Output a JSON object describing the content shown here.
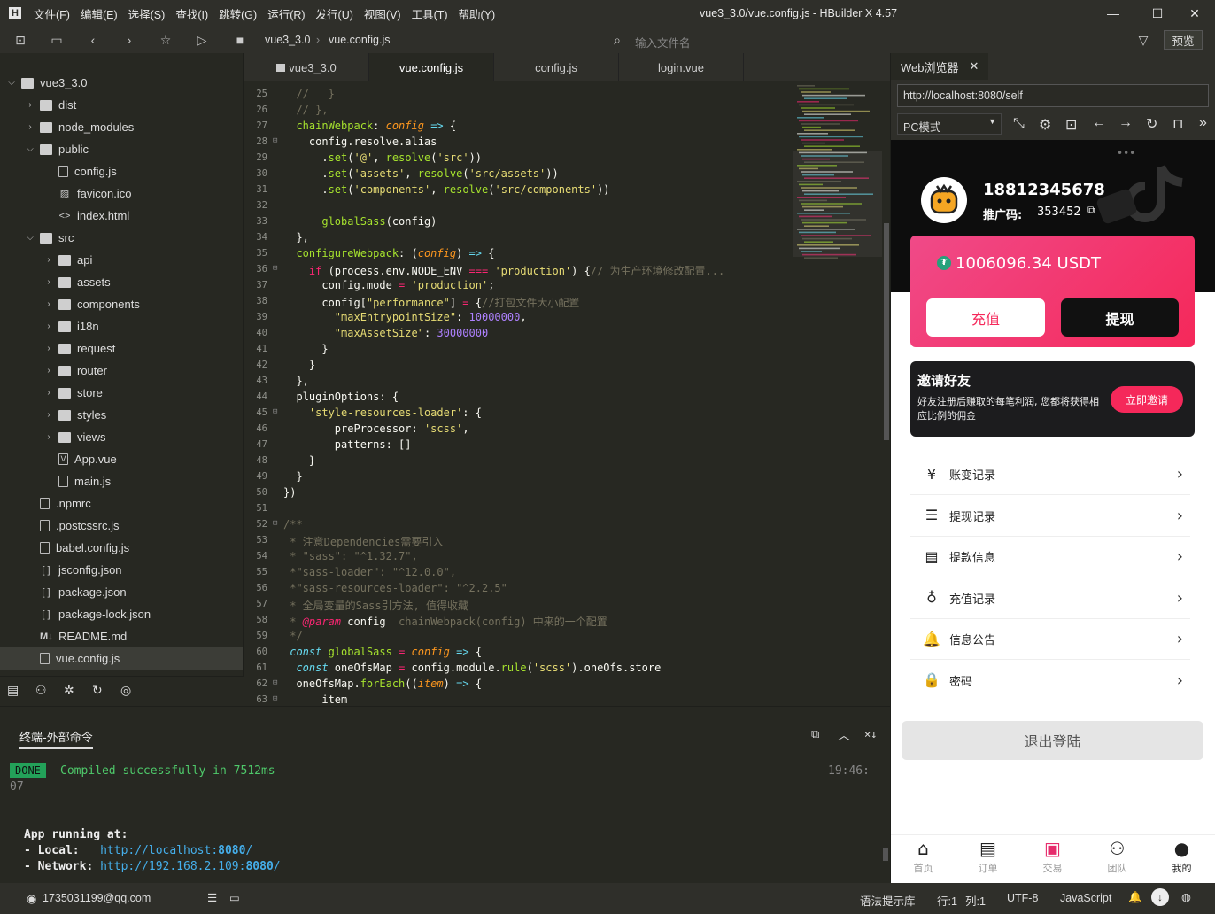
{
  "titlebar": {
    "logo": "H",
    "menu": [
      "文件(F)",
      "编辑(E)",
      "选择(S)",
      "查找(I)",
      "跳转(G)",
      "运行(R)",
      "发行(U)",
      "视图(V)",
      "工具(T)",
      "帮助(Y)"
    ],
    "title": "vue3_3.0/vue.config.js - HBuilder X 4.57"
  },
  "toolbar": {
    "breadcrumb": [
      "vue3_3.0",
      "vue.config.js"
    ],
    "file_search_placeholder": "输入文件名",
    "preview_label": "预览"
  },
  "tree": [
    {
      "label": "vue3_3.0",
      "depth": 0,
      "type": "folder",
      "arrow": "down"
    },
    {
      "label": "dist",
      "depth": 1,
      "type": "folder",
      "arrow": "right"
    },
    {
      "label": "node_modules",
      "depth": 1,
      "type": "folder",
      "arrow": "right"
    },
    {
      "label": "public",
      "depth": 1,
      "type": "folder",
      "arrow": "down"
    },
    {
      "label": "config.js",
      "depth": 2,
      "type": "file",
      "arrow": ""
    },
    {
      "label": "favicon.ico",
      "depth": 2,
      "type": "image",
      "arrow": ""
    },
    {
      "label": "index.html",
      "depth": 2,
      "type": "html",
      "arrow": ""
    },
    {
      "label": "src",
      "depth": 1,
      "type": "folder",
      "arrow": "down"
    },
    {
      "label": "api",
      "depth": 2,
      "type": "folder",
      "arrow": "right"
    },
    {
      "label": "assets",
      "depth": 2,
      "type": "folder",
      "arrow": "right"
    },
    {
      "label": "components",
      "depth": 2,
      "type": "folder",
      "arrow": "right"
    },
    {
      "label": "i18n",
      "depth": 2,
      "type": "folder",
      "arrow": "right"
    },
    {
      "label": "request",
      "depth": 2,
      "type": "folder",
      "arrow": "right"
    },
    {
      "label": "router",
      "depth": 2,
      "type": "folder",
      "arrow": "right"
    },
    {
      "label": "store",
      "depth": 2,
      "type": "folder",
      "arrow": "right"
    },
    {
      "label": "styles",
      "depth": 2,
      "type": "folder",
      "arrow": "right"
    },
    {
      "label": "views",
      "depth": 2,
      "type": "folder",
      "arrow": "right"
    },
    {
      "label": "App.vue",
      "depth": 2,
      "type": "vue",
      "arrow": ""
    },
    {
      "label": "main.js",
      "depth": 2,
      "type": "file",
      "arrow": ""
    },
    {
      "label": ".npmrc",
      "depth": 1,
      "type": "file",
      "arrow": ""
    },
    {
      "label": ".postcssrc.js",
      "depth": 1,
      "type": "file",
      "arrow": ""
    },
    {
      "label": "babel.config.js",
      "depth": 1,
      "type": "file",
      "arrow": ""
    },
    {
      "label": "jsconfig.json",
      "depth": 1,
      "type": "json",
      "arrow": ""
    },
    {
      "label": "package.json",
      "depth": 1,
      "type": "json",
      "arrow": ""
    },
    {
      "label": "package-lock.json",
      "depth": 1,
      "type": "json",
      "arrow": ""
    },
    {
      "label": "README.md",
      "depth": 1,
      "type": "md",
      "arrow": ""
    },
    {
      "label": "vue.config.js",
      "depth": 1,
      "type": "file",
      "arrow": "",
      "selected": true
    }
  ],
  "tabs": [
    "vue3_3.0",
    "vue.config.js",
    "config.js",
    "login.vue"
  ],
  "code_lines": [
    {
      "n": "25",
      "fold": "",
      "html": "  <span class='c'>//   }</span>"
    },
    {
      "n": "26",
      "fold": "",
      "html": "  <span class='c'>// },</span>"
    },
    {
      "n": "27",
      "fold": "",
      "html": "  <span class='f'>chainWebpack</span>: <span class='i'>config</span> <span class='b'>=></span> {"
    },
    {
      "n": "28",
      "fold": "⊟",
      "html": "    config.resolve.alias"
    },
    {
      "n": "29",
      "fold": "",
      "html": "      .<span class='f'>set</span>(<span class='s'>'@'</span>, <span class='f'>resolve</span>(<span class='s'>'src'</span>))"
    },
    {
      "n": "30",
      "fold": "",
      "html": "      .<span class='f'>set</span>(<span class='s'>'assets'</span>, <span class='f'>resolve</span>(<span class='s'>'src/assets'</span>))"
    },
    {
      "n": "31",
      "fold": "",
      "html": "      .<span class='f'>set</span>(<span class='s'>'components'</span>, <span class='f'>resolve</span>(<span class='s'>'src/components'</span>))"
    },
    {
      "n": "32",
      "fold": "",
      "html": ""
    },
    {
      "n": "33",
      "fold": "",
      "html": "      <span class='f'>globalSass</span>(config)"
    },
    {
      "n": "34",
      "fold": "",
      "html": "  },"
    },
    {
      "n": "35",
      "fold": "",
      "html": "  <span class='f'>configureWebpack</span>: (<span class='i'>config</span>) <span class='b'>=></span> {"
    },
    {
      "n": "36",
      "fold": "⊟",
      "html": "    <span class='k'>if</span> (process.env.NODE_ENV <span class='k'>===</span> <span class='s'>'production'</span>) {<span class='c'>// 为生产环境修改配置...</span>"
    },
    {
      "n": "37",
      "fold": "",
      "html": "      config.mode <span class='k'>=</span> <span class='s'>'production'</span>;"
    },
    {
      "n": "38",
      "fold": "",
      "html": "      config[<span class='s'>\"performance\"</span>] <span class='k'>=</span> {<span class='c'>//打包文件大小配置</span>"
    },
    {
      "n": "39",
      "fold": "",
      "html": "        <span class='s'>\"maxEntrypointSize\"</span>: <span class='n'>10000000</span>,"
    },
    {
      "n": "40",
      "fold": "",
      "html": "        <span class='s'>\"maxAssetSize\"</span>: <span class='n'>30000000</span>"
    },
    {
      "n": "41",
      "fold": "",
      "html": "      }"
    },
    {
      "n": "42",
      "fold": "",
      "html": "    }"
    },
    {
      "n": "43",
      "fold": "",
      "html": "  },"
    },
    {
      "n": "44",
      "fold": "",
      "html": "  pluginOptions: {"
    },
    {
      "n": "45",
      "fold": "⊟",
      "html": "    <span class='s'>'style-resources-loader'</span>: {"
    },
    {
      "n": "46",
      "fold": "",
      "html": "        preProcessor: <span class='s'>'scss'</span>,"
    },
    {
      "n": "47",
      "fold": "",
      "html": "        patterns: []"
    },
    {
      "n": "48",
      "fold": "",
      "html": "    }"
    },
    {
      "n": "49",
      "fold": "",
      "html": "  }"
    },
    {
      "n": "50",
      "fold": "",
      "html": "})"
    },
    {
      "n": "51",
      "fold": "",
      "html": ""
    },
    {
      "n": "52",
      "fold": "⊟",
      "html": "<span class='c'>/**</span>"
    },
    {
      "n": "53",
      "fold": "",
      "html": "<span class='c'> * 注意Dependencies需要引入</span>"
    },
    {
      "n": "54",
      "fold": "",
      "html": "<span class='c'> * \"sass\": \"^1.32.7\",</span>"
    },
    {
      "n": "55",
      "fold": "",
      "html": "<span class='c'> *\"sass-loader\": \"^12.0.0\",</span>"
    },
    {
      "n": "56",
      "fold": "",
      "html": "<span class='c'> *\"sass-resources-loader\": \"^2.2.5\"</span>"
    },
    {
      "n": "57",
      "fold": "",
      "html": "<span class='c'> * 全局变量的Sass引方法, 值得收藏</span>"
    },
    {
      "n": "58",
      "fold": "",
      "html": "<span class='c'> * </span><span class='b' style='color:#f92672'>@param</span> config  <span class='c'>chainWebpack(config) 中来的一个配置</span>"
    },
    {
      "n": "59",
      "fold": "",
      "html": "<span class='c'> */</span>"
    },
    {
      "n": "60",
      "fold": "",
      "html": " <span class='b'>const</span> <span class='f'>globalSass</span> <span class='k'>=</span> <span class='i'>config</span> <span class='b'>=></span> {"
    },
    {
      "n": "61",
      "fold": "",
      "html": "  <span class='b'>const</span> oneOfsMap <span class='k'>=</span> config.module.<span class='f'>rule</span>(<span class='s'>'scss'</span>).oneOfs.store"
    },
    {
      "n": "62",
      "fold": "⊟",
      "html": "  oneOfsMap.<span class='f'>forEach</span>((<span class='i'>item</span>) <span class='b'>=></span> {"
    },
    {
      "n": "63",
      "fold": "⊟",
      "html": "      item"
    }
  ],
  "terminal": {
    "tab_label": "终端-外部命令",
    "done_badge": "DONE",
    "compiled_msg": "Compiled successfully in 7512ms",
    "time": "19:46:",
    "time_wrap": "07",
    "running_label": "App running at:",
    "local_label": "- Local:   ",
    "local_url": "http://localhost:",
    "local_port": "8080",
    "local_slash": "/",
    "network_label": "- Network: ",
    "network_url": "http://192.168.2.109:",
    "network_port": "8080",
    "network_slash": "/"
  },
  "statusbar": {
    "account": "1735031199@qq.com",
    "syntax_lib": "语法提示库",
    "row": "行:1",
    "col": "列:1",
    "encoding": "UTF-8",
    "language": "JavaScript"
  },
  "browser": {
    "tab_label": "Web浏览器",
    "url": "http://localhost:8080/self",
    "mode": "PC模式"
  },
  "app": {
    "phone": "18812345678",
    "promo_label": "推广码:",
    "promo_code": "353452",
    "balance": "1006096.34 USDT",
    "recharge": "充值",
    "withdraw": "提现",
    "invite_title": "邀请好友",
    "invite_desc": "好友注册后赚取的每笔利润, 您都将获得相应比例的佣金",
    "invite_btn": "立即邀请",
    "menu": [
      "账变记录",
      "提现记录",
      "提款信息",
      "充值记录",
      "信息公告",
      "密码"
    ],
    "logout": "退出登陆",
    "nav": [
      "首页",
      "订单",
      "交易",
      "团队",
      "我的"
    ],
    "colors": {
      "accent": "#f5285a",
      "nav_active": "#222222"
    }
  }
}
